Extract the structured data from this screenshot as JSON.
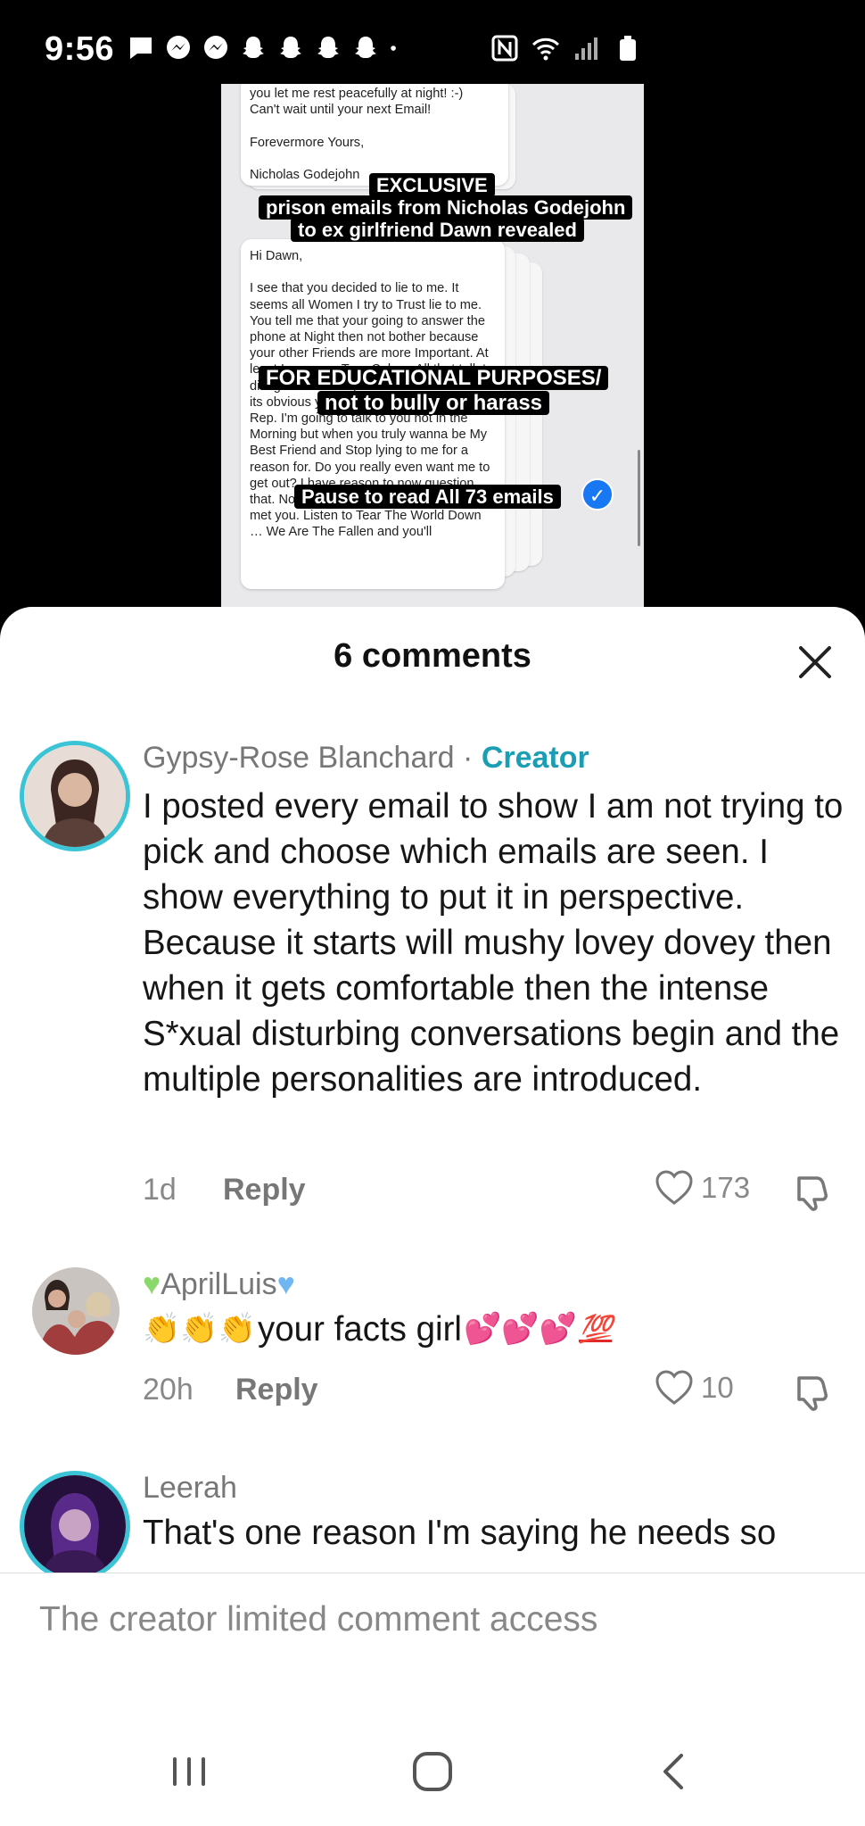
{
  "status_bar": {
    "time": "9:56",
    "notification_icons": [
      "chat-icon",
      "messenger-icon",
      "messenger-icon",
      "snapchat-icon",
      "snapchat-icon",
      "snapchat-icon",
      "snapchat-icon",
      "dot-icon"
    ],
    "system_icons": [
      "nfc-icon",
      "wifi-icon",
      "signal-icon",
      "battery-icon"
    ]
  },
  "video": {
    "email_top": "you let me rest peacefully at night! :-)\nCan't wait until your next Email!\n\nForevermore Yours,\n\nNicholas Godejohn",
    "email_main": "Hi Dawn,\n\nI see that you decided to lie to me. It seems all Women I try to Trust lie to me. You tell me that your going to answer the phone at Night then not bother because your other Friends are more Important. At least I see your True Colors. All that talk to disagree out with you talk to Mine. Since its obvious your Word isn't good with its Rep. I'm going to talk to you not in the Morning but when you truly wanna be My Best Friend and Stop lying to me for a reason for. Do you really even want me to get out? I have reason to now question that. Now I'm back to where I was before I met you. Listen to Tear The World Down … We Are The Fallen and you'll",
    "caption_1": "EXCLUSIVE",
    "caption_2": "prison emails from Nicholas Godejohn",
    "caption_3": "to ex girlfriend Dawn revealed",
    "caption_4": "FOR EDUCATIONAL PURPOSES/",
    "caption_5": "not to bully or harass",
    "caption_6": "Pause to read All 73 emails"
  },
  "comments_sheet": {
    "title": "6 comments",
    "comments": [
      {
        "author": "Gypsy-Rose Blanchard",
        "separator": " · ",
        "badge": "Creator",
        "text": "I posted every email to show I am not trying to pick and choose which emails are seen. I show everything to put it in perspective. Because it starts will mushy lovey dovey then when it gets comfortable then the intense S*xual disturbing conversations begin and the multiple personalities are introduced.",
        "time": "1d",
        "reply": "Reply",
        "likes": "173"
      },
      {
        "author": "AprilLuis",
        "text": "your facts girl",
        "time": "20h",
        "reply": "Reply",
        "likes": "10"
      },
      {
        "author": "Leerah",
        "text": "That's one reason I'm saying he needs so"
      }
    ],
    "limited_notice": "The creator limited comment access"
  },
  "nav_bar": {
    "buttons": [
      "recent-apps-icon",
      "home-icon",
      "back-icon"
    ]
  }
}
